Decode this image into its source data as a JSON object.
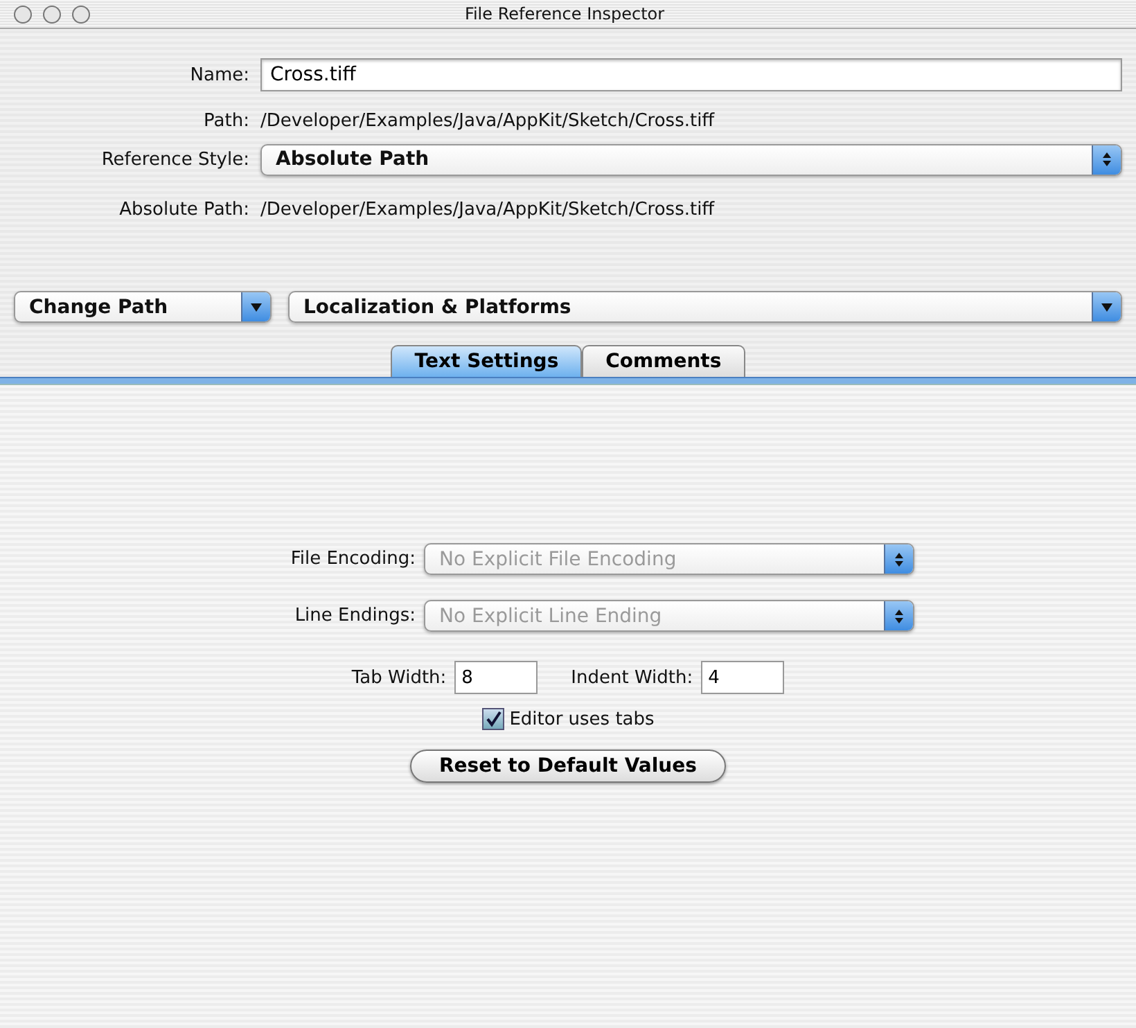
{
  "window": {
    "title": "File Reference Inspector"
  },
  "name_field": {
    "label": "Name:",
    "value": "Cross.tiff"
  },
  "path": {
    "label": "Path:",
    "value": "/Developer/Examples/Java/AppKit/Sketch/Cross.tiff"
  },
  "reference_style": {
    "label": "Reference Style:",
    "value": "Absolute Path",
    "kind": "popup",
    "disabled": false
  },
  "absolute_path": {
    "label": "Absolute Path:",
    "value": "/Developer/Examples/Java/AppKit/Sketch/Cross.tiff"
  },
  "menus": [
    {
      "value": "Change Path",
      "kind": "pulldown",
      "disabled": false
    },
    {
      "value": "Localization & Platforms",
      "kind": "pulldown",
      "disabled": false
    }
  ],
  "tabs": [
    {
      "label": "Text Settings",
      "selected": true
    },
    {
      "label": "Comments",
      "selected": false
    }
  ],
  "settings": [
    {
      "label": "File Encoding:",
      "value": "No Explicit File Encoding",
      "kind": "popup",
      "disabled": true
    },
    {
      "label": "Line Endings:",
      "value": "No Explicit Line Ending",
      "kind": "popup",
      "disabled": true
    }
  ],
  "widths": [
    {
      "label": "Tab Width:",
      "value": "8"
    },
    {
      "label": "Indent Width:",
      "value": "4"
    }
  ],
  "checkbox": {
    "label": "Editor uses tabs",
    "checked": true
  },
  "reset_button": "Reset to Default Values"
}
